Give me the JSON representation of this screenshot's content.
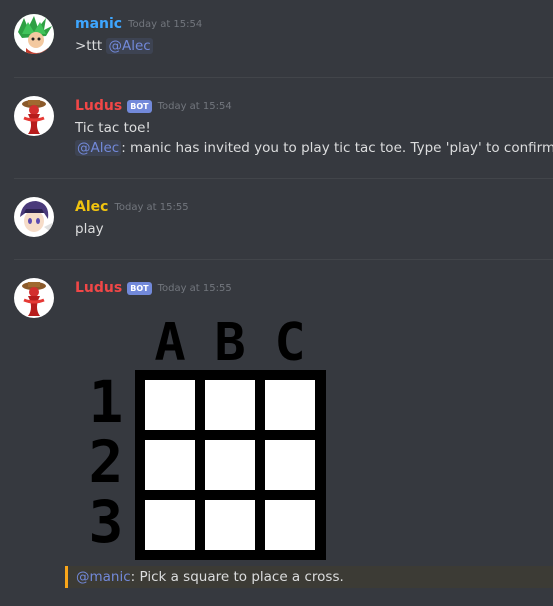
{
  "colors": {
    "background": "#36393f",
    "manic": "#3ea6ff",
    "ludus": "#f04747",
    "alec": "#f1c40f",
    "mention": "#7289da",
    "bot_tag": "#7289da",
    "timestamp": "#72767d",
    "text": "#dcddde",
    "quote_bar": "#faa61a"
  },
  "messages": [
    {
      "author": "manic",
      "timestamp": "Today at 15:54",
      "avatar_icon": "green-spiky-hair-avatar-icon",
      "lines": [
        {
          "prefix": ">ttt ",
          "mention": "@Alec",
          "suffix": ""
        }
      ]
    },
    {
      "author": "Ludus",
      "bot_tag": "BOT",
      "timestamp": "Today at 15:54",
      "avatar_icon": "red-mascot-avatar-icon",
      "lines": [
        {
          "text": "Tic tac toe!"
        },
        {
          "mention": "@Alec",
          "suffix": ": manic has invited you to play tic tac toe. Type 'play' to confirm."
        }
      ]
    },
    {
      "author": "Alec",
      "timestamp": "Today at 15:55",
      "avatar_icon": "purple-hair-anime-avatar-icon",
      "lines": [
        {
          "text": "play"
        }
      ]
    },
    {
      "author": "Ludus",
      "bot_tag": "BOT",
      "timestamp": "Today at 15:55",
      "avatar_icon": "red-mascot-avatar-icon",
      "board": {
        "columns": [
          "A",
          "B",
          "C"
        ],
        "rows": [
          "1",
          "2",
          "3"
        ],
        "cells": [
          [
            "",
            "",
            ""
          ],
          [
            "",
            "",
            ""
          ],
          [
            "",
            "",
            ""
          ]
        ]
      },
      "quote": {
        "mention": "@manic",
        "suffix": ": Pick a square to place a cross."
      }
    }
  ]
}
